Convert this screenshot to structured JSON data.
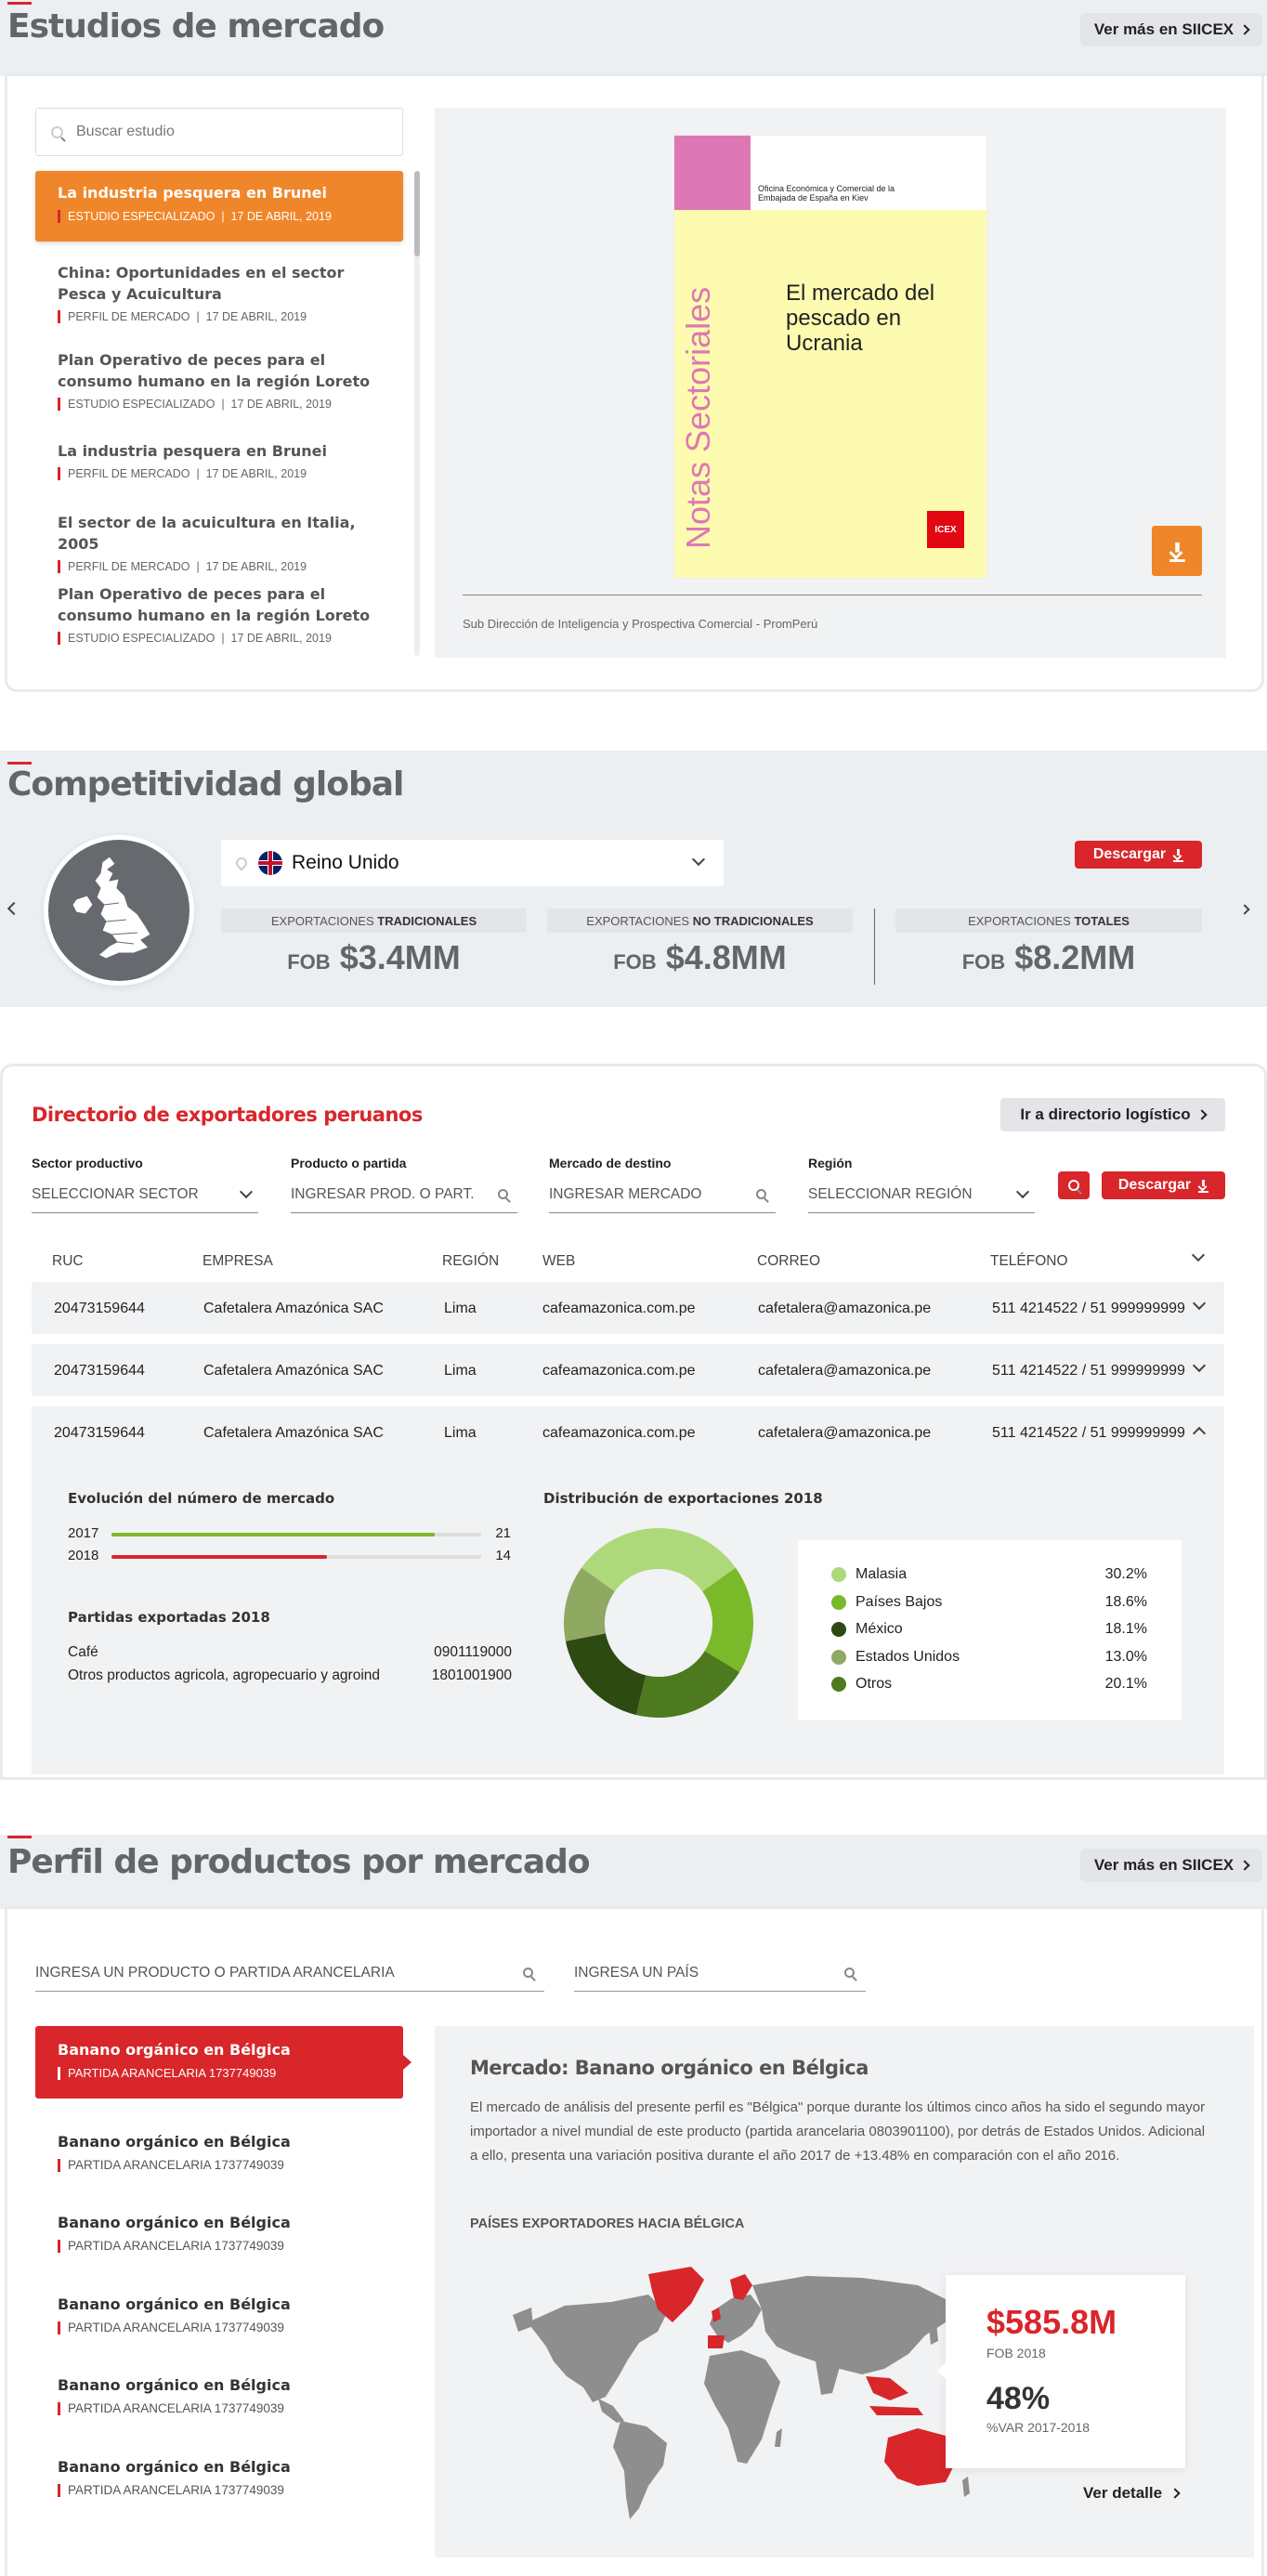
{
  "studies": {
    "title": "Estudios de mercado",
    "more_label": "Ver más en SIICEX",
    "search_placeholder": "Buscar estudio",
    "items": [
      {
        "title": "La industria pesquera en Brunei",
        "meta": "ESTUDIO ESPECIALIZADO  |  17 DE ABRIL, 2019"
      },
      {
        "title": "China: Oportunidades en el sector Pesca y Acuicultura",
        "meta": "PERFIL DE MERCADO  |  17 DE ABRIL, 2019"
      },
      {
        "title": "Plan Operativo de peces para el consumo humano en la región Loreto",
        "meta": "ESTUDIO ESPECIALIZADO  |  17 DE ABRIL, 2019"
      },
      {
        "title": "La industria pesquera en Brunei",
        "meta": "PERFIL DE MERCADO  |  17 DE ABRIL, 2019"
      },
      {
        "title": "El sector de la acuicultura en Italia, 2005",
        "meta": "PERFIL DE MERCADO  |  17 DE ABRIL, 2019"
      },
      {
        "title": "Plan Operativo de peces para el consumo humano en la región Loreto",
        "meta": "ESTUDIO ESPECIALIZADO  |  17 DE ABRIL, 2019"
      }
    ],
    "cover": {
      "org": "Oficina Económica y Comercial de la Embajada de España en Kiev",
      "vertical": "Notas Sectoriales",
      "doc_title": "El mercado del pescado en Ucrania",
      "logo": "ICEX"
    },
    "source": "Sub Dirección de Inteligencia y Prospectiva Comercial - PromPerú"
  },
  "competitiveness": {
    "title": "Competitividad global",
    "country": "Reino Unido",
    "download_label": "Descargar",
    "stats": [
      {
        "label_pre": "EXPORTACIONES ",
        "label_bold": "TRADICIONALES",
        "prefix": "FOB",
        "value": "$3.4MM"
      },
      {
        "label_pre": "EXPORTACIONES ",
        "label_bold": "NO TRADICIONALES",
        "prefix": "FOB",
        "value": "$4.8MM"
      },
      {
        "label_pre": "EXPORTACIONES ",
        "label_bold": "TOTALES",
        "prefix": "FOB",
        "value": "$8.2MM"
      }
    ]
  },
  "directory": {
    "title": "Directorio de exportadores peruanos",
    "logistics_label": "Ir a directorio logístico",
    "download_label": "Descargar",
    "filters": [
      {
        "label": "Sector productivo",
        "placeholder": "SELECCIONAR SECTOR",
        "icon": "chevron-down"
      },
      {
        "label": "Producto o partida",
        "placeholder": "INGRESAR PROD. O PART.",
        "icon": "search"
      },
      {
        "label": "Mercado de destino",
        "placeholder": "INGRESAR MERCADO",
        "icon": "search"
      },
      {
        "label": "Región",
        "placeholder": "SELECCIONAR REGIÓN",
        "icon": "chevron-down"
      }
    ],
    "columns": [
      "RUC",
      "EMPRESA",
      "REGIÓN",
      "WEB",
      "CORREO",
      "TELÉFONO"
    ],
    "rows": [
      {
        "ruc": "20473159644",
        "empresa": "Cafetalera Amazónica SAC",
        "region": "Lima",
        "web": "cafeamazonica.com.pe",
        "correo": "cafetalera@amazonica.pe",
        "telefono": "511 4214522 / 51 999999999"
      },
      {
        "ruc": "20473159644",
        "empresa": "Cafetalera Amazónica SAC",
        "region": "Lima",
        "web": "cafeamazonica.com.pe",
        "correo": "cafetalera@amazonica.pe",
        "telefono": "511 4214522 / 51 999999999"
      },
      {
        "ruc": "20473159644",
        "empresa": "Cafetalera Amazónica SAC",
        "region": "Lima",
        "web": "cafeamazonica.com.pe",
        "correo": "cafetalera@amazonica.pe",
        "telefono": "511 4214522 / 51 999999999"
      }
    ],
    "detail": {
      "evolution_title": "Evolución del número de mercado",
      "evolution": [
        {
          "year": "2017",
          "value": 21,
          "color": "#7ab929"
        },
        {
          "year": "2018",
          "value": 14,
          "color": "#d8262b"
        }
      ],
      "evolution_max": 24,
      "partidas_title": "Partidas exportadas 2018",
      "partidas": [
        {
          "name": "Café",
          "code": "0901119000"
        },
        {
          "name": "Otros productos agricola, agropecuario y agroind",
          "code": "1801001900"
        }
      ],
      "distribution_title": "Distribución de exportaciones 2018",
      "distribution": [
        {
          "name": "Malasia",
          "pct": "30.2%",
          "value": 30.2,
          "color": "#aed97a"
        },
        {
          "name": "Países Bajos",
          "pct": "18.6%",
          "value": 18.6,
          "color": "#7ab929"
        },
        {
          "name": "México",
          "pct": "18.1%",
          "value": 18.1,
          "color": "#2d4a12"
        },
        {
          "name": "Estados Unidos",
          "pct": "13.0%",
          "value": 13.0,
          "color": "#8fa862"
        },
        {
          "name": "Otros",
          "pct": "20.1%",
          "value": 20.1,
          "color": "#4d7a1e"
        }
      ]
    }
  },
  "products": {
    "title": "Perfil de productos por mercado",
    "more_label": "Ver más en SIICEX",
    "product_placeholder": "INGRESA UN PRODUCTO O PARTIDA ARANCELARIA",
    "country_placeholder": "INGRESA UN PAÍS",
    "items": [
      {
        "title": "Banano orgánico en Bélgica",
        "meta": "PARTIDA ARANCELARIA 1737749039"
      },
      {
        "title": "Banano orgánico en Bélgica",
        "meta": "PARTIDA ARANCELARIA 1737749039"
      },
      {
        "title": "Banano orgánico en Bélgica",
        "meta": "PARTIDA ARANCELARIA 1737749039"
      },
      {
        "title": "Banano orgánico en Bélgica",
        "meta": "PARTIDA ARANCELARIA 1737749039"
      },
      {
        "title": "Banano orgánico en Bélgica",
        "meta": "PARTIDA ARANCELARIA 1737749039"
      },
      {
        "title": "Banano orgánico en Bélgica",
        "meta": "PARTIDA ARANCELARIA 1737749039"
      }
    ],
    "detail": {
      "heading": "Mercado: Banano orgánico en Bélgica",
      "body": "El mercado de análisis del presente perfil es \"Bélgica\" porque durante los últimos cinco años ha sido el segundo mayor importador a nivel mundial de este producto (partida arancelaria 0803901100), por detrás de Estados Unidos. Adicional a ello, presenta una variación positiva durante el año 2017 de +13.48% en comparación con el año 2016.",
      "subheading": "PAÍSES EXPORTADORES HACIA BÉLGICA",
      "fob_value": "$585.8M",
      "fob_label": "FOB 2018",
      "var_value": "48%",
      "var_label": "%VAR 2017-2018",
      "detail_link": "Ver detalle"
    }
  }
}
